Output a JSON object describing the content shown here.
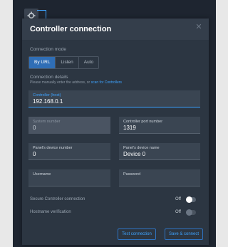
{
  "dialog": {
    "title": "Controller connection",
    "close_icon": "close-icon"
  },
  "connection_mode": {
    "label": "Connection mode",
    "options": [
      "By URL",
      "Listen",
      "Auto"
    ],
    "selected": "By URL"
  },
  "connection_details": {
    "label": "Connection details",
    "hint_prefix": "Please manually enter the address, or",
    "hint_link": "scan for Controllers"
  },
  "fields": {
    "controller_host": {
      "label": "Controller (host)",
      "value": "192.168.0.1"
    },
    "system_number": {
      "label": "System number",
      "value": "0"
    },
    "controller_port": {
      "label": "Controller port number",
      "value": "1319"
    },
    "panel_device_number": {
      "label": "Panel's device number",
      "value": "0"
    },
    "panel_device_name": {
      "label": "Panel's device name",
      "value": "Device 0"
    },
    "username": {
      "label": "Username",
      "value": ""
    },
    "password": {
      "label": "Password",
      "value": ""
    }
  },
  "toggles": {
    "secure": {
      "label": "Secure Controller connection",
      "state": "Off"
    },
    "hostname": {
      "label": "Hostname verification",
      "state": "Off"
    }
  },
  "buttons": {
    "test": "Test connection",
    "save": "Save & connect"
  },
  "colors": {
    "accent": "#3da3ff",
    "selected_segment": "#2f6eb6",
    "dialog_bg": "#2c3642"
  }
}
